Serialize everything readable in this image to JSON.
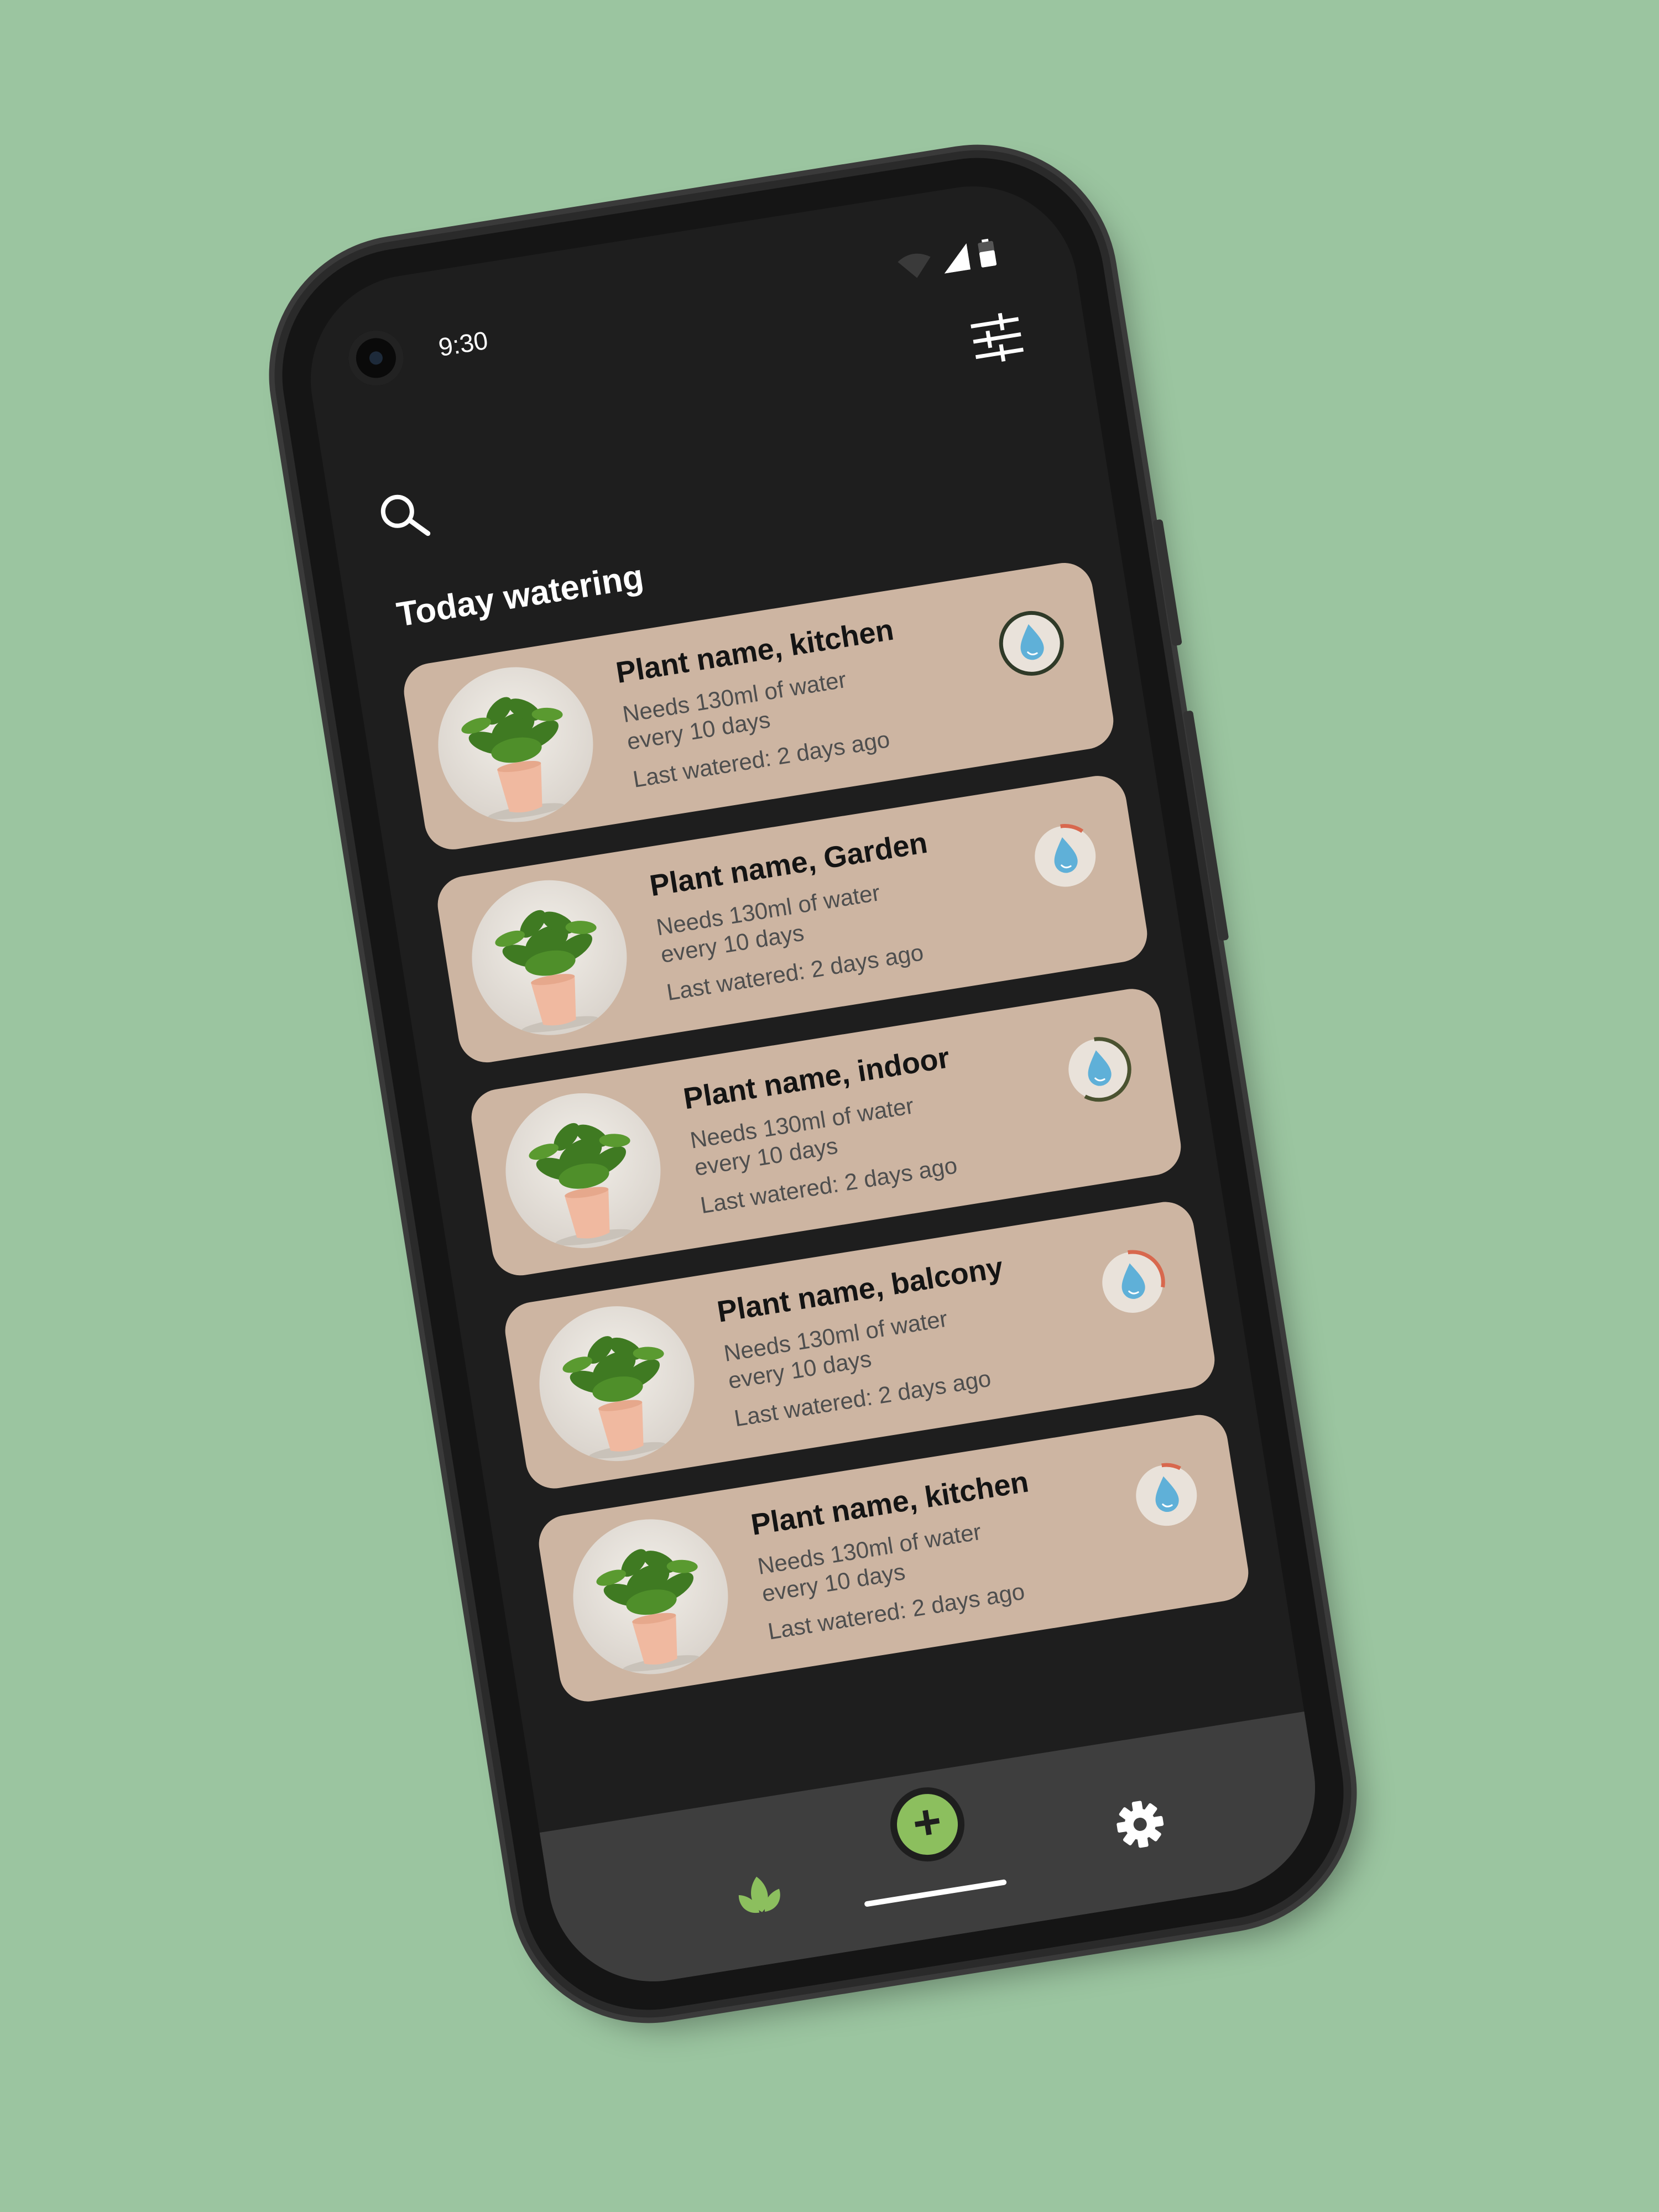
{
  "status_bar": {
    "time": "9:30",
    "icons": [
      "wifi-icon",
      "signal-icon",
      "battery-icon"
    ]
  },
  "toolbar": {
    "filter_icon": "sliders-icon",
    "search_icon": "search-icon"
  },
  "section": {
    "title": "Today watering"
  },
  "plants": [
    {
      "name": "Plant name, kitchen",
      "needs": "Needs 130ml of water every 10 days",
      "last_watered": "Last watered: 2 days ago",
      "progress": 1.0,
      "progress_color": "#2f3a28"
    },
    {
      "name": "Plant name, Garden",
      "needs": "Needs 130ml of water every 10 days",
      "last_watered": "Last watered: 2 days ago",
      "progress": 0.12,
      "progress_color": "#d8684e"
    },
    {
      "name": "Plant name, indoor",
      "needs": "Needs 130ml of water every 10 days",
      "last_watered": "Last watered: 2 days ago",
      "progress": 0.6,
      "progress_color": "#4a5230"
    },
    {
      "name": "Plant name, balcony",
      "needs": "Needs 130ml of water every 10 days",
      "last_watered": "Last watered: 2 days ago",
      "progress": 0.3,
      "progress_color": "#d8684e"
    },
    {
      "name": "Plant name, kitchen",
      "needs": "Needs 130ml of water every 10 days",
      "last_watered": "Last watered: 2 days ago",
      "progress": 0.1,
      "progress_color": "#d8684e"
    }
  ],
  "bottom_nav": {
    "items": [
      "plants-icon",
      "add-icon",
      "settings-icon"
    ],
    "add_symbol": "+",
    "accent": "#8cbf5e"
  },
  "colors": {
    "background": "#9bc5a0",
    "screen": "#1e1e1e",
    "card": "#cdb5a2",
    "drop": "#5fb0d8"
  }
}
